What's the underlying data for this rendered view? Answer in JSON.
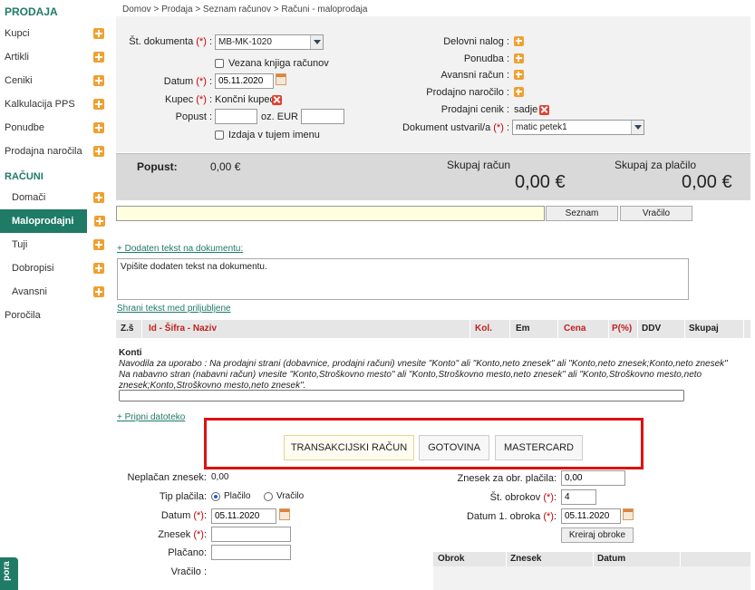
{
  "sidebar": {
    "heading_prodaja": "PRODAJA",
    "items_prodaja": [
      {
        "label": "Kupci"
      },
      {
        "label": "Artikli"
      },
      {
        "label": "Ceniki"
      },
      {
        "label": "Kalkulacija PPS"
      },
      {
        "label": "Ponudbe"
      },
      {
        "label": "Prodajna naročila"
      }
    ],
    "heading_racuni": "RAČUNI",
    "items_racuni": [
      {
        "label": "Domači"
      },
      {
        "label": "Maloprodajni"
      },
      {
        "label": "Tuji"
      },
      {
        "label": "Dobropisi"
      },
      {
        "label": "Avansni"
      }
    ],
    "porocila": "Poročila",
    "support": "pora"
  },
  "breadcrumb": "Domov  >  Prodaja  >  Seznam računov  >  Računi - maloprodaja",
  "form": {
    "st_dokumenta_label": "Št. dokumenta",
    "req": "(*)",
    "colon": ":",
    "st_dokumenta_value": "MB-MK-1020",
    "vezana_label": "Vezana knjiga računov",
    "datum_label": "Datum",
    "datum_value": "05.11.2020",
    "kupec_label": "Kupec",
    "kupec_value": "Končni kupec",
    "popust_label": "Popust :",
    "oz_eur_label": "oz. EUR :",
    "izdaja_label": "Izdaja v tujem imenu",
    "delovni_nalog": "Delovni nalog :",
    "ponudba": "Ponudba :",
    "avansni_racun": "Avansni račun :",
    "prodajno_narocilo": "Prodajno naročilo :",
    "prodajni_cenik": "Prodajni cenik :",
    "prodajni_cenik_value": "sadje",
    "dokument_ustvaril": "Dokument ustvaril/a",
    "dokument_ustvaril_value": "matic petek1"
  },
  "totals": {
    "popust_label": "Popust:",
    "popust_value": "0,00 €",
    "skupaj_label": "Skupaj račun",
    "skupaj_value": "0,00 €",
    "placilo_label": "Skupaj za plačilo",
    "placilo_value": "0,00 €"
  },
  "search": {
    "seznam": "Seznam",
    "vracilo": "Vračilo"
  },
  "doc_text": {
    "add_link": "+ Dodaten tekst na dokumentu:",
    "placeholder": "Vpišite dodaten tekst na dokumentu.",
    "save_link": "Shrani tekst med priljubljene"
  },
  "table_headers": [
    "Z.š",
    "Id - Šifra - Naziv",
    "Kol.",
    "Em",
    "Cena",
    "P(%)",
    "DDV",
    "Skupaj"
  ],
  "konti": {
    "title": "Konti",
    "line1": "Navodila za uporabo : Na prodajni strani (dobavnice, prodajni računi) vnesite \"Konto\" ali \"Konto,neto znesek\" ali \"Konto,neto znesek;Konto,neto znesek\"",
    "line2": "Na nabavno stran (nabavni račun) vnesite \"Konto,Stroškovno mesto\" ali \"Konto,Stroškovno mesto,neto znesek\" ali \"Konto,Stroškovno mesto,neto znesek;Konto,Stroškovno mesto,neto znesek\"."
  },
  "attach_link": "+ Pripni datoteko",
  "payment_buttons": [
    "TRANSAKCIJSKI RAČUN",
    "GOTOVINA",
    "MASTERCARD"
  ],
  "payment": {
    "neplacan_label": "Neplačan znesek:",
    "neplacan_value": "0,00",
    "tip_label": "Tip plačila:",
    "placilo_opt": "Plačilo",
    "vracilo_opt": "Vračilo",
    "datum_label": "Datum",
    "datum_value": "05.11.2020",
    "znesek_label": "Znesek",
    "placano_label": "Plačano:",
    "vracilo_label": "Vračilo :",
    "znesek_obr_label": "Znesek za obr. plačila:",
    "znesek_obr_value": "0,00",
    "st_obrokov_label": "Št. obrokov",
    "st_obrokov_value": "4",
    "datum_obroka_label": "Datum 1. obroka",
    "datum_obroka_value": "05.11.2020",
    "kreiraj_btn": "Kreiraj obroke"
  },
  "installments_headers": [
    "Obrok",
    "Znesek",
    "Datum"
  ]
}
